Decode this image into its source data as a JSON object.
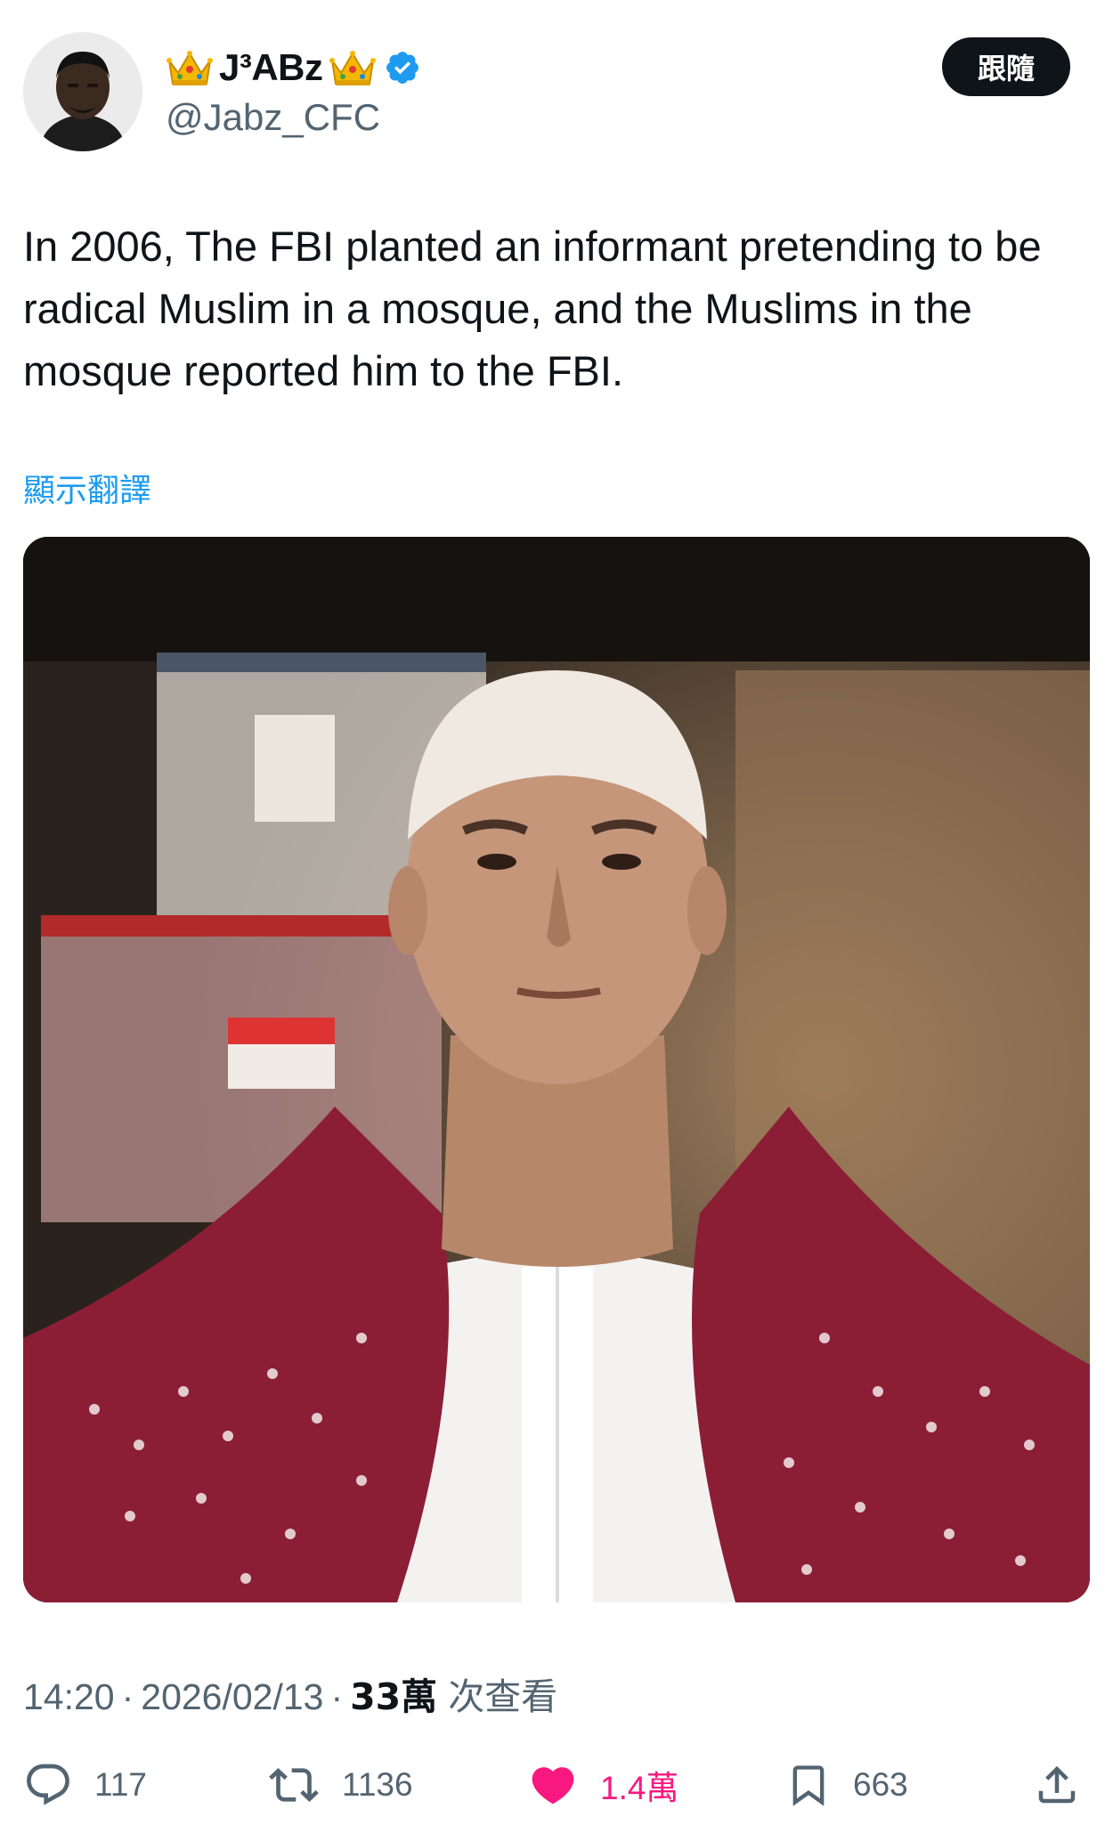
{
  "header": {
    "display_name": "J³ABz",
    "handle": "@Jabz_CFC",
    "follow_label": "跟隨"
  },
  "tweet": {
    "text": "In 2006, The FBI planted an informant pretending to be radical Muslim in a mosque, and the Muslims in the mosque reported him to the FBI.",
    "translate_label": "顯示翻譯"
  },
  "meta": {
    "time": "14:20",
    "date": "2026/02/13",
    "views_count": "33萬",
    "views_label": "次查看"
  },
  "actions": {
    "replies": "117",
    "reposts": "1136",
    "likes": "1.4萬",
    "bookmarks": "663"
  },
  "colors": {
    "accent": "#1d9bf0",
    "like": "#f91880",
    "text_primary": "#0f1419",
    "text_secondary": "#536471"
  },
  "icons": [
    "crown-emoji",
    "verified-badge-icon",
    "reply-icon",
    "repost-icon",
    "like-heart-icon",
    "bookmark-icon",
    "share-icon"
  ]
}
